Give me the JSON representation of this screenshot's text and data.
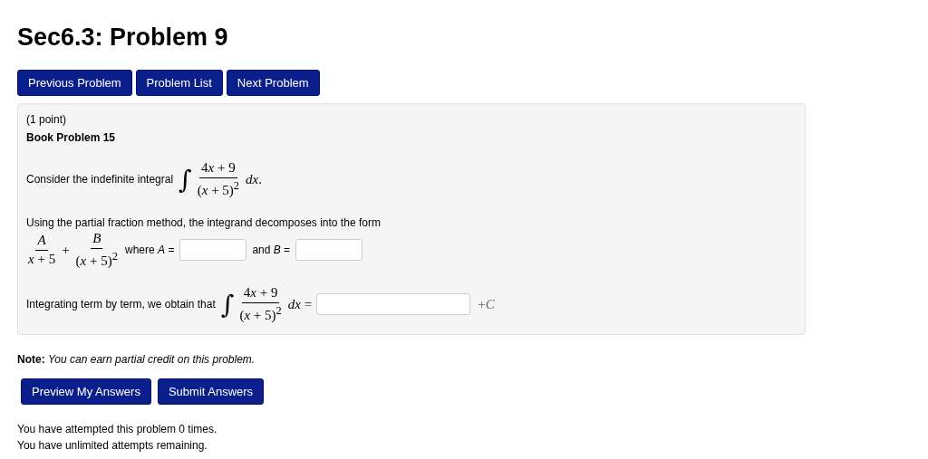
{
  "title": "Sec6.3: Problem 9",
  "nav_buttons": [
    "Previous Problem",
    "Problem List",
    "Next Problem"
  ],
  "problem": {
    "points": "(1 point)",
    "heading": "Book Problem 15",
    "intro": "Consider the indefinite integral",
    "integral": {
      "symbol": "∫",
      "coefficient": "4",
      "numerator": "*x* + 9",
      "denominator": "(*x* + 5)$^{2}$",
      "differential": "*dx*."
    },
    "decompose_text": "Using the partial fraction method, the integrand decomposes into the form",
    "fractions": [
      {
        "numerator": "*A*",
        "denominator": "*x* + 5"
      },
      {
        "numerator": "*B*",
        "denominator": "(*x* + 5)$^{2}$"
      }
    ],
    "plus": "+",
    "field_labels": [
      "where *A* =",
      "and *B* ="
    ],
    "integrate_text": "Integrating term by term, we obtain that",
    "integral2": {
      "symbol": "∫",
      "coefficient": "4",
      "numerator": "*x* + 9",
      "denominator": "(*x* + 5)$^{2}$",
      "differential": "*dx* ="
    },
    "constant": "+*C*"
  },
  "note": {
    "label": "Note:",
    "text": "You can earn partial credit on this problem."
  },
  "action_buttons": [
    "Preview My Answers",
    "Submit Answers"
  ],
  "attempts": [
    "You have attempted this problem 0 times.",
    "You have unlimited attempts remaining."
  ]
}
